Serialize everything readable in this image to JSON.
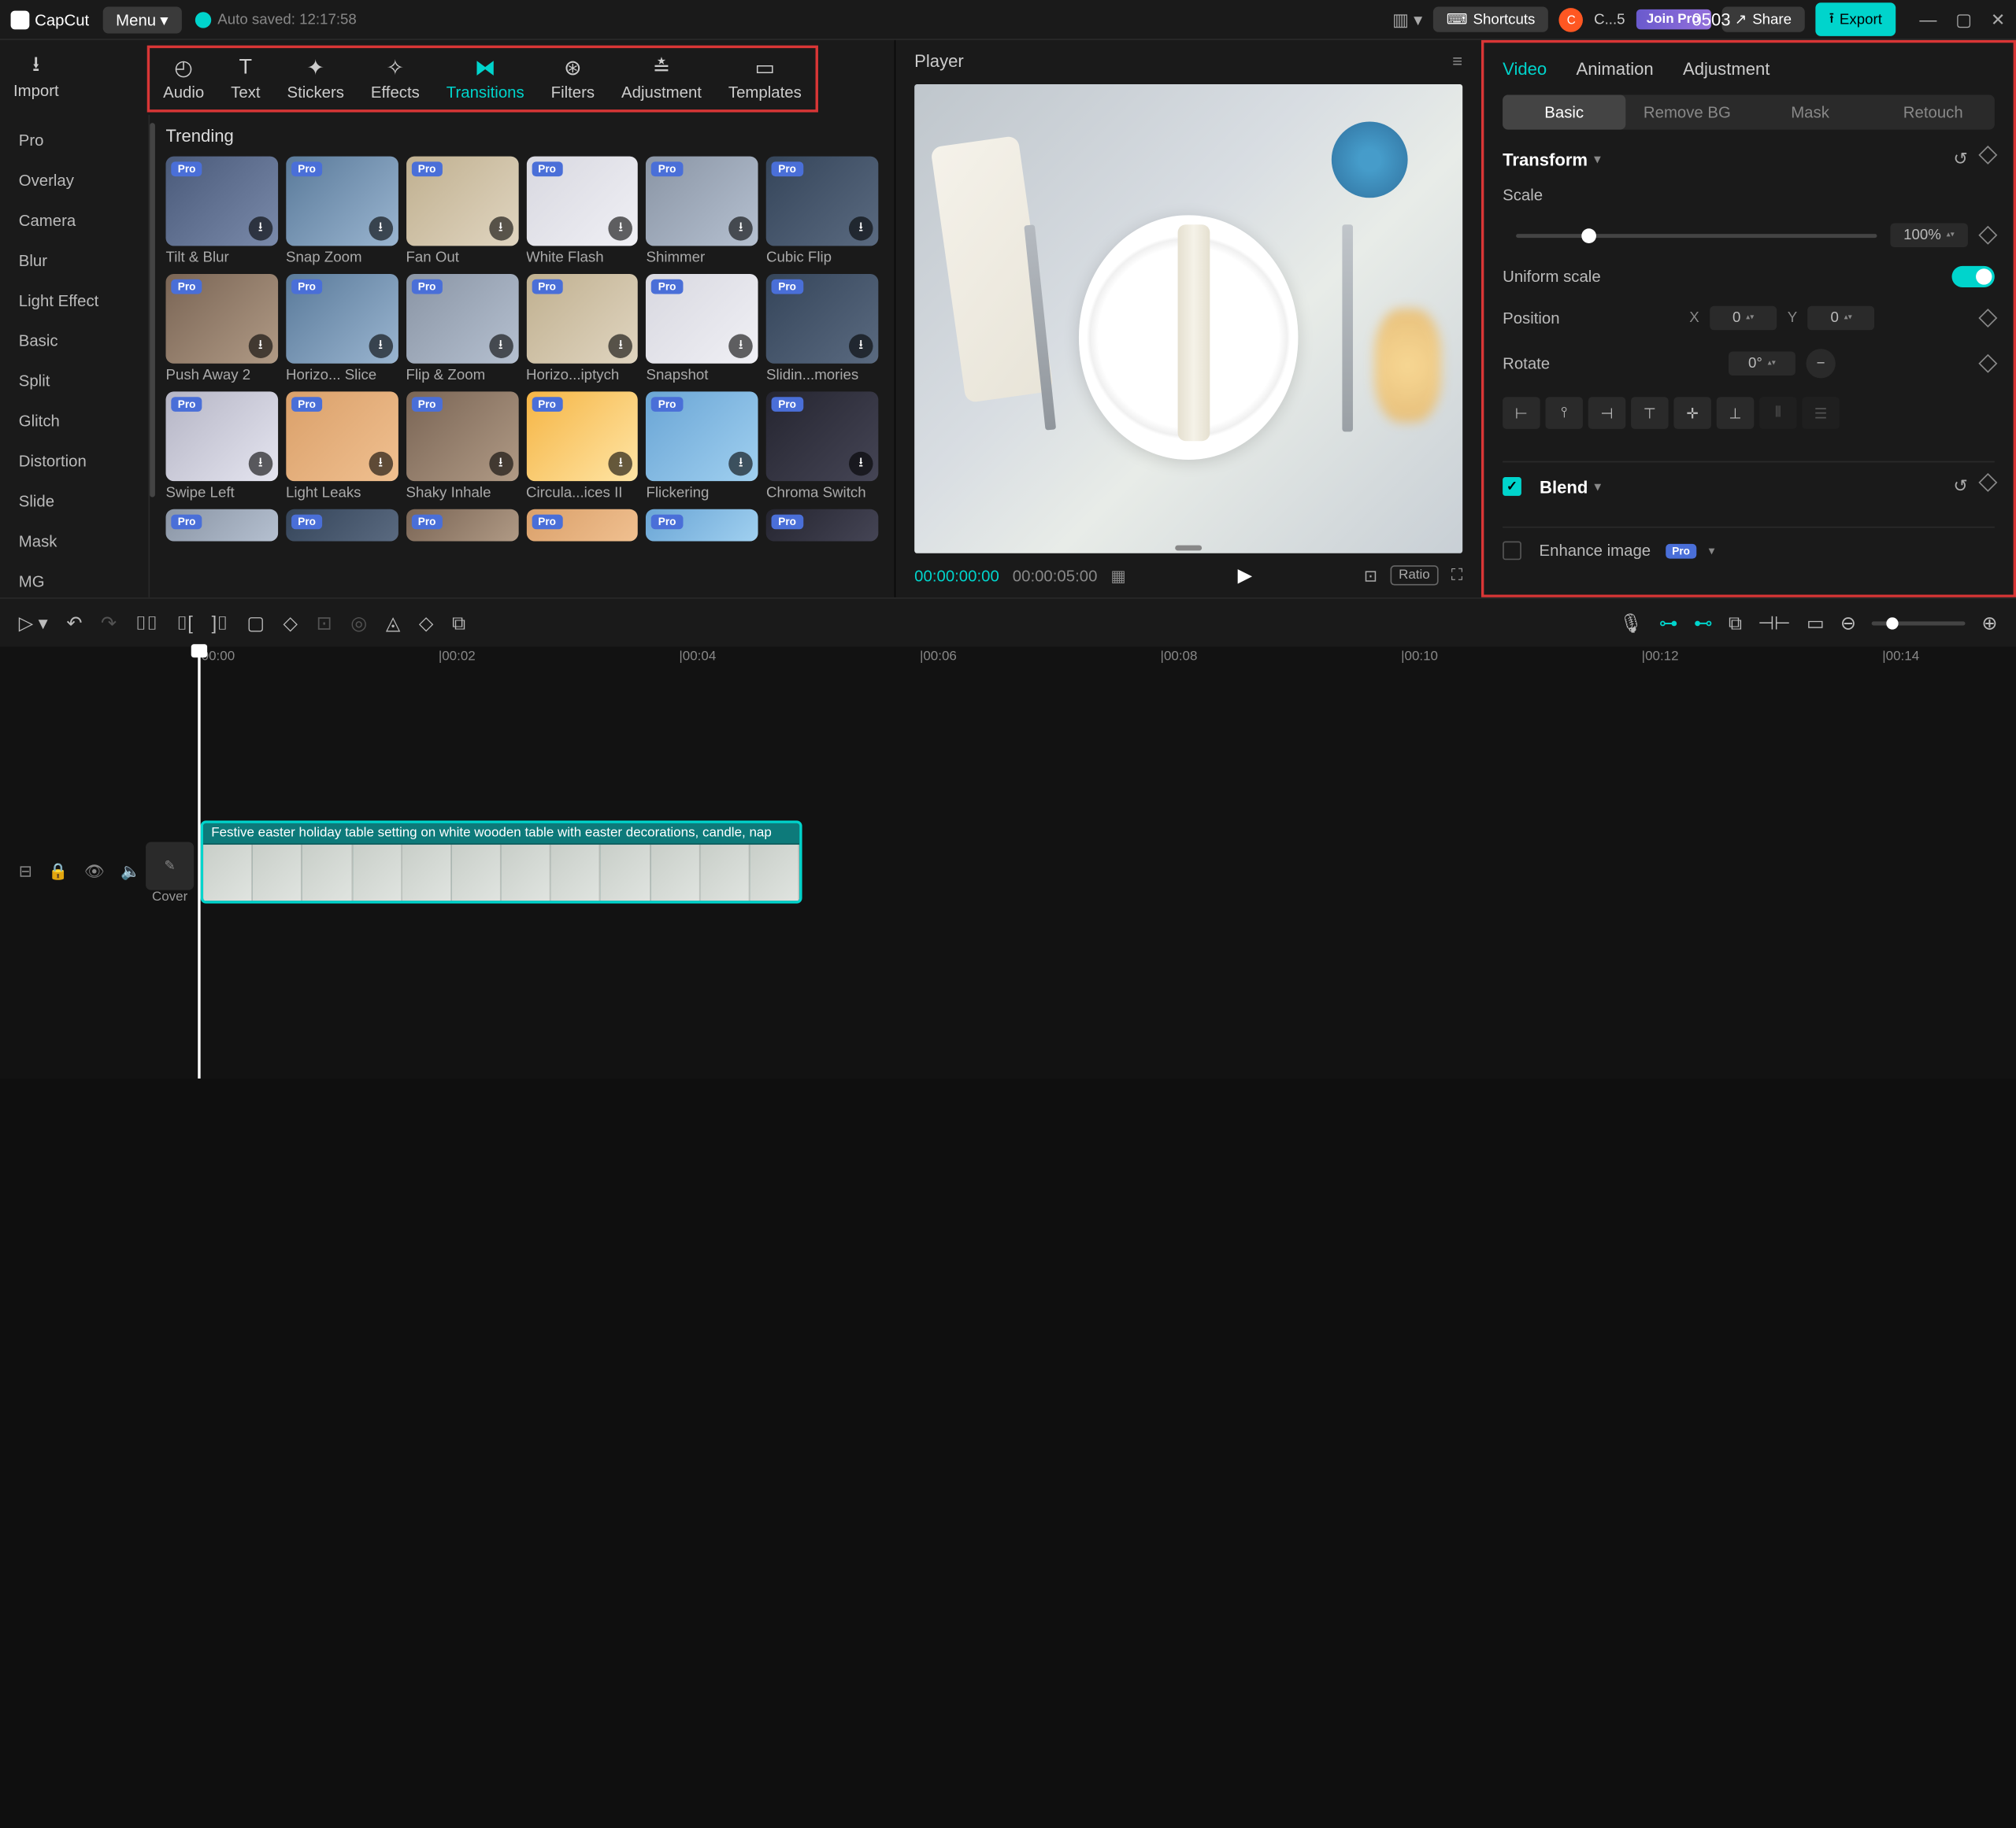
{
  "titlebar": {
    "app": "CapCut",
    "menu": "Menu",
    "autosave": "Auto saved: 12:17:58",
    "project_title": "0503",
    "shortcuts": "Shortcuts",
    "avatar_label": "C...5",
    "join_pro": "Join Pro",
    "share": "Share",
    "export": "Export"
  },
  "top_tabs": {
    "import": "Import",
    "items": [
      {
        "label": "Audio"
      },
      {
        "label": "Text"
      },
      {
        "label": "Stickers"
      },
      {
        "label": "Effects"
      },
      {
        "label": "Transitions"
      },
      {
        "label": "Filters"
      },
      {
        "label": "Adjustment"
      },
      {
        "label": "Templates"
      }
    ]
  },
  "sidebar": {
    "items": [
      {
        "label": "Pro"
      },
      {
        "label": "Overlay"
      },
      {
        "label": "Camera"
      },
      {
        "label": "Blur"
      },
      {
        "label": "Light Effect"
      },
      {
        "label": "Basic"
      },
      {
        "label": "Split"
      },
      {
        "label": "Glitch"
      },
      {
        "label": "Distortion"
      },
      {
        "label": "Slide"
      },
      {
        "label": "Mask"
      },
      {
        "label": "MG"
      }
    ]
  },
  "content": {
    "header": "Trending",
    "items": [
      {
        "label": "Tilt & Blur"
      },
      {
        "label": "Snap Zoom"
      },
      {
        "label": "Fan Out"
      },
      {
        "label": "White Flash"
      },
      {
        "label": "Shimmer"
      },
      {
        "label": "Cubic Flip"
      },
      {
        "label": "Push Away 2"
      },
      {
        "label": "Horizo... Slice"
      },
      {
        "label": "Flip & Zoom"
      },
      {
        "label": "Horizo...iptych"
      },
      {
        "label": "Snapshot"
      },
      {
        "label": "Slidin...mories"
      },
      {
        "label": "Swipe Left"
      },
      {
        "label": "Light Leaks"
      },
      {
        "label": "Shaky Inhale"
      },
      {
        "label": "Circula...ices II"
      },
      {
        "label": "Flickering"
      },
      {
        "label": "Chroma Switch"
      }
    ],
    "pro_label": "Pro"
  },
  "player": {
    "title": "Player",
    "time_current": "00:00:00:00",
    "time_total": "00:00:05:00",
    "ratio": "Ratio"
  },
  "inspector": {
    "tabs": {
      "video": "Video",
      "animation": "Animation",
      "adjustment": "Adjustment"
    },
    "subtabs": {
      "basic": "Basic",
      "removebg": "Remove BG",
      "mask": "Mask",
      "retouch": "Retouch"
    },
    "transform": "Transform",
    "scale_label": "Scale",
    "scale_value": "100%",
    "uniform": "Uniform scale",
    "position_label": "Position",
    "pos_x_label": "X",
    "pos_x": "0",
    "pos_y_label": "Y",
    "pos_y": "0",
    "rotate_label": "Rotate",
    "rotate_value": "0°",
    "blend": "Blend",
    "enhance": "Enhance image",
    "pro_chip": "Pro"
  },
  "timeline": {
    "ruler": [
      "00:00",
      "00:02",
      "00:04",
      "00:06",
      "00:08",
      "00:10",
      "00:12",
      "00:14"
    ],
    "clip_label": "Festive easter holiday table setting on white wooden table with easter decorations, candle, nap",
    "cover": "Cover"
  }
}
